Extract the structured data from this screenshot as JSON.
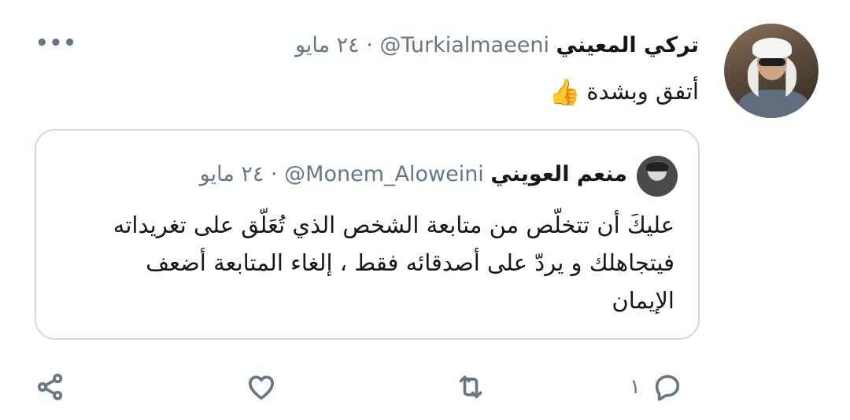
{
  "tweet": {
    "author_name": "تركي المعيني",
    "handle": "@Turkialmaeeni",
    "separator": "·",
    "date": "٢٤ مايو",
    "text": "أتفق وبشدة",
    "emoji": "👍",
    "more_label": "•••"
  },
  "quoted": {
    "author_name": "منعم العويني",
    "handle": "@Monem_Aloweini",
    "separator": "·",
    "date": "٢٤ مايو",
    "lines": [
      "عليكَ أن تتخلّص من متابعة الشخص الذي تُعَلّق على تغريداته",
      "فيتجاهلك و يردّ على أصدقائه فقط ، إلغاء المتابعة أضعف",
      "الإيمان"
    ]
  },
  "actions": {
    "reply_count": "١",
    "icons": [
      "reply-icon",
      "retweet-icon",
      "like-icon",
      "share-icon"
    ]
  },
  "colors": {
    "text": "#14171a",
    "muted": "#657786",
    "border": "#cfd9de"
  }
}
